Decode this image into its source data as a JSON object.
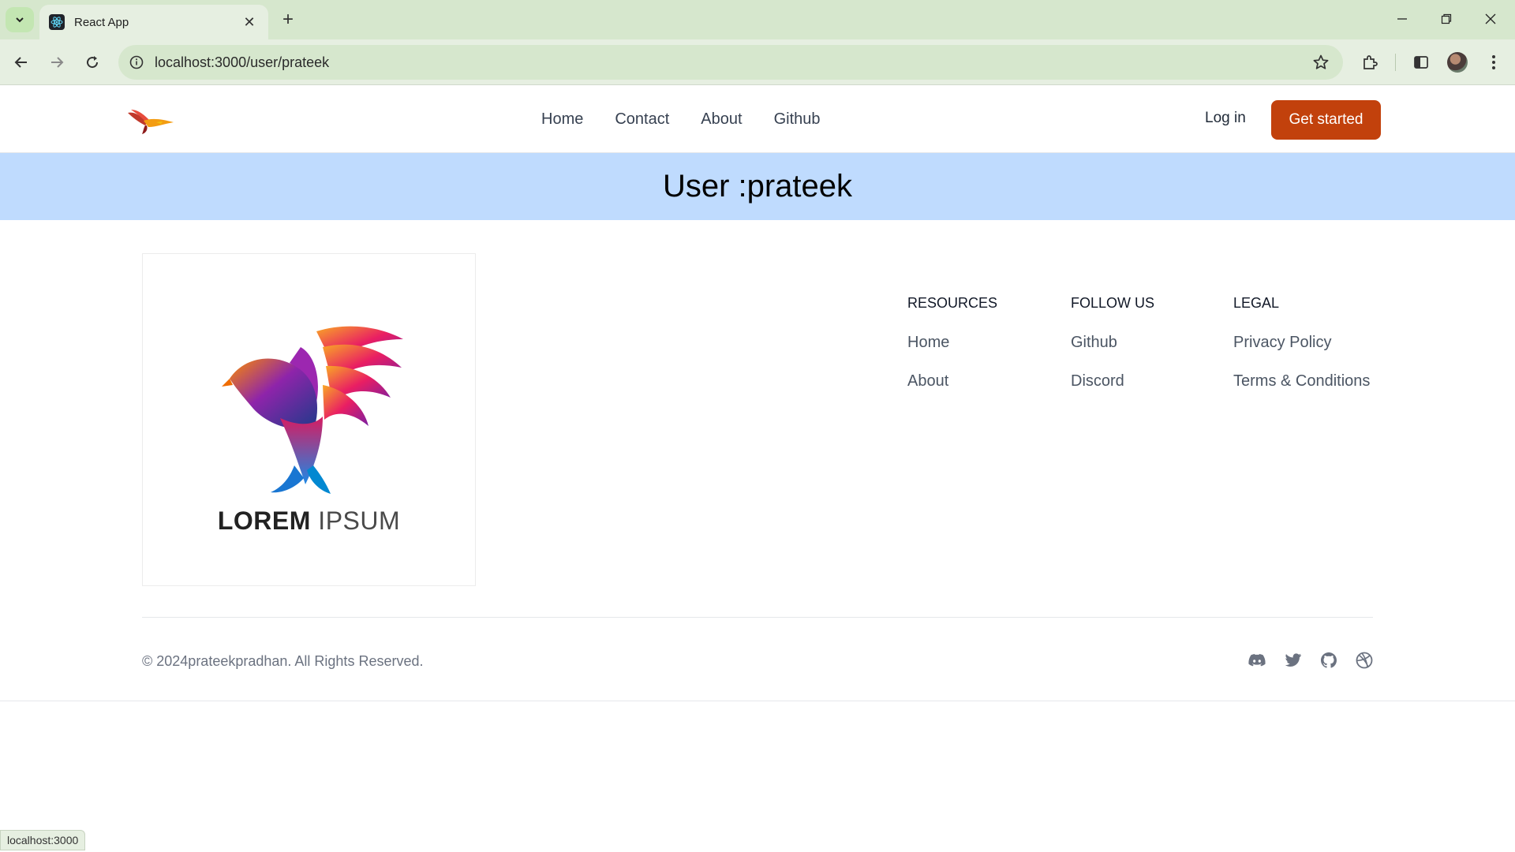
{
  "browser": {
    "tab_title": "React App",
    "url": "localhost:3000/user/prateek",
    "status_url": "localhost:3000"
  },
  "header": {
    "nav": [
      "Home",
      "Contact",
      "About",
      "Github"
    ],
    "login_label": "Log in",
    "cta_label": "Get started"
  },
  "banner": {
    "title": "User :prateek"
  },
  "footer": {
    "logo_text_bold": "LOREM",
    "logo_text_light": "IPSUM",
    "columns": [
      {
        "heading": "RESOURCES",
        "links": [
          "Home",
          "About"
        ]
      },
      {
        "heading": "FOLLOW US",
        "links": [
          "Github",
          "Discord"
        ]
      },
      {
        "heading": "LEGAL",
        "links": [
          "Privacy Policy",
          "Terms & Conditions"
        ]
      }
    ],
    "copyright": "© 2024prateekpradhan. All Rights Reserved.",
    "social_icons": [
      "discord-icon",
      "twitter-icon",
      "github-icon",
      "dribbble-icon"
    ]
  },
  "colors": {
    "cta": "#c2410c",
    "banner": "#bfdbfe",
    "chrome": "#d6e7cd"
  }
}
